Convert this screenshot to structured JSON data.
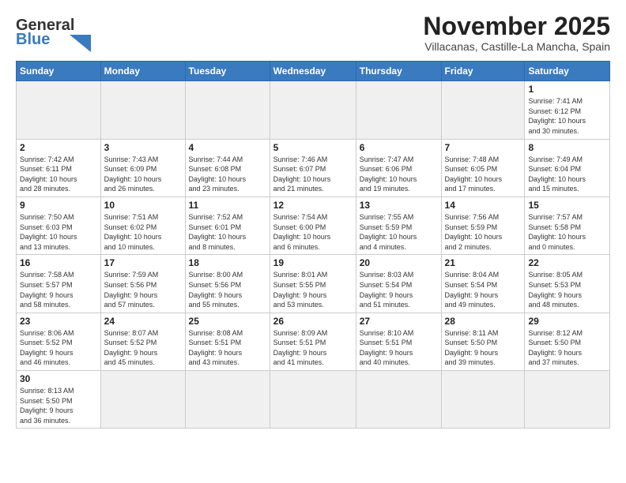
{
  "header": {
    "logo_general": "General",
    "logo_blue": "Blue",
    "month_title": "November 2025",
    "subtitle": "Villacanas, Castille-La Mancha, Spain"
  },
  "weekdays": [
    "Sunday",
    "Monday",
    "Tuesday",
    "Wednesday",
    "Thursday",
    "Friday",
    "Saturday"
  ],
  "weeks": [
    [
      {
        "day": "",
        "info": ""
      },
      {
        "day": "",
        "info": ""
      },
      {
        "day": "",
        "info": ""
      },
      {
        "day": "",
        "info": ""
      },
      {
        "day": "",
        "info": ""
      },
      {
        "day": "",
        "info": ""
      },
      {
        "day": "1",
        "info": "Sunrise: 7:41 AM\nSunset: 6:12 PM\nDaylight: 10 hours\nand 30 minutes."
      }
    ],
    [
      {
        "day": "2",
        "info": "Sunrise: 7:42 AM\nSunset: 6:11 PM\nDaylight: 10 hours\nand 28 minutes."
      },
      {
        "day": "3",
        "info": "Sunrise: 7:43 AM\nSunset: 6:09 PM\nDaylight: 10 hours\nand 26 minutes."
      },
      {
        "day": "4",
        "info": "Sunrise: 7:44 AM\nSunset: 6:08 PM\nDaylight: 10 hours\nand 23 minutes."
      },
      {
        "day": "5",
        "info": "Sunrise: 7:46 AM\nSunset: 6:07 PM\nDaylight: 10 hours\nand 21 minutes."
      },
      {
        "day": "6",
        "info": "Sunrise: 7:47 AM\nSunset: 6:06 PM\nDaylight: 10 hours\nand 19 minutes."
      },
      {
        "day": "7",
        "info": "Sunrise: 7:48 AM\nSunset: 6:05 PM\nDaylight: 10 hours\nand 17 minutes."
      },
      {
        "day": "8",
        "info": "Sunrise: 7:49 AM\nSunset: 6:04 PM\nDaylight: 10 hours\nand 15 minutes."
      }
    ],
    [
      {
        "day": "9",
        "info": "Sunrise: 7:50 AM\nSunset: 6:03 PM\nDaylight: 10 hours\nand 13 minutes."
      },
      {
        "day": "10",
        "info": "Sunrise: 7:51 AM\nSunset: 6:02 PM\nDaylight: 10 hours\nand 10 minutes."
      },
      {
        "day": "11",
        "info": "Sunrise: 7:52 AM\nSunset: 6:01 PM\nDaylight: 10 hours\nand 8 minutes."
      },
      {
        "day": "12",
        "info": "Sunrise: 7:54 AM\nSunset: 6:00 PM\nDaylight: 10 hours\nand 6 minutes."
      },
      {
        "day": "13",
        "info": "Sunrise: 7:55 AM\nSunset: 5:59 PM\nDaylight: 10 hours\nand 4 minutes."
      },
      {
        "day": "14",
        "info": "Sunrise: 7:56 AM\nSunset: 5:59 PM\nDaylight: 10 hours\nand 2 minutes."
      },
      {
        "day": "15",
        "info": "Sunrise: 7:57 AM\nSunset: 5:58 PM\nDaylight: 10 hours\nand 0 minutes."
      }
    ],
    [
      {
        "day": "16",
        "info": "Sunrise: 7:58 AM\nSunset: 5:57 PM\nDaylight: 9 hours\nand 58 minutes."
      },
      {
        "day": "17",
        "info": "Sunrise: 7:59 AM\nSunset: 5:56 PM\nDaylight: 9 hours\nand 57 minutes."
      },
      {
        "day": "18",
        "info": "Sunrise: 8:00 AM\nSunset: 5:56 PM\nDaylight: 9 hours\nand 55 minutes."
      },
      {
        "day": "19",
        "info": "Sunrise: 8:01 AM\nSunset: 5:55 PM\nDaylight: 9 hours\nand 53 minutes."
      },
      {
        "day": "20",
        "info": "Sunrise: 8:03 AM\nSunset: 5:54 PM\nDaylight: 9 hours\nand 51 minutes."
      },
      {
        "day": "21",
        "info": "Sunrise: 8:04 AM\nSunset: 5:54 PM\nDaylight: 9 hours\nand 49 minutes."
      },
      {
        "day": "22",
        "info": "Sunrise: 8:05 AM\nSunset: 5:53 PM\nDaylight: 9 hours\nand 48 minutes."
      }
    ],
    [
      {
        "day": "23",
        "info": "Sunrise: 8:06 AM\nSunset: 5:52 PM\nDaylight: 9 hours\nand 46 minutes."
      },
      {
        "day": "24",
        "info": "Sunrise: 8:07 AM\nSunset: 5:52 PM\nDaylight: 9 hours\nand 45 minutes."
      },
      {
        "day": "25",
        "info": "Sunrise: 8:08 AM\nSunset: 5:51 PM\nDaylight: 9 hours\nand 43 minutes."
      },
      {
        "day": "26",
        "info": "Sunrise: 8:09 AM\nSunset: 5:51 PM\nDaylight: 9 hours\nand 41 minutes."
      },
      {
        "day": "27",
        "info": "Sunrise: 8:10 AM\nSunset: 5:51 PM\nDaylight: 9 hours\nand 40 minutes."
      },
      {
        "day": "28",
        "info": "Sunrise: 8:11 AM\nSunset: 5:50 PM\nDaylight: 9 hours\nand 39 minutes."
      },
      {
        "day": "29",
        "info": "Sunrise: 8:12 AM\nSunset: 5:50 PM\nDaylight: 9 hours\nand 37 minutes."
      }
    ],
    [
      {
        "day": "30",
        "info": "Sunrise: 8:13 AM\nSunset: 5:50 PM\nDaylight: 9 hours\nand 36 minutes."
      },
      {
        "day": "",
        "info": ""
      },
      {
        "day": "",
        "info": ""
      },
      {
        "day": "",
        "info": ""
      },
      {
        "day": "",
        "info": ""
      },
      {
        "day": "",
        "info": ""
      },
      {
        "day": "",
        "info": ""
      }
    ]
  ]
}
